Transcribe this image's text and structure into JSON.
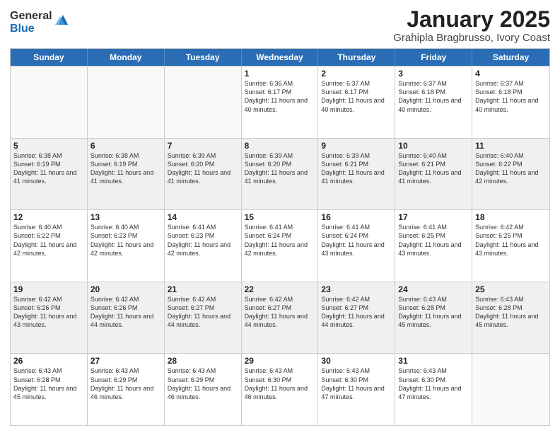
{
  "logo": {
    "general": "General",
    "blue": "Blue"
  },
  "title": {
    "month": "January 2025",
    "location": "Grahipla Bragbrusso, Ivory Coast"
  },
  "calendar": {
    "headers": [
      "Sunday",
      "Monday",
      "Tuesday",
      "Wednesday",
      "Thursday",
      "Friday",
      "Saturday"
    ],
    "rows": [
      [
        {
          "day": "",
          "info": "",
          "empty": true
        },
        {
          "day": "",
          "info": "",
          "empty": true
        },
        {
          "day": "",
          "info": "",
          "empty": true
        },
        {
          "day": "1",
          "info": "Sunrise: 6:36 AM\nSunset: 6:17 PM\nDaylight: 11 hours\nand 40 minutes."
        },
        {
          "day": "2",
          "info": "Sunrise: 6:37 AM\nSunset: 6:17 PM\nDaylight: 11 hours\nand 40 minutes."
        },
        {
          "day": "3",
          "info": "Sunrise: 6:37 AM\nSunset: 6:18 PM\nDaylight: 11 hours\nand 40 minutes."
        },
        {
          "day": "4",
          "info": "Sunrise: 6:37 AM\nSunset: 6:18 PM\nDaylight: 11 hours\nand 40 minutes."
        }
      ],
      [
        {
          "day": "5",
          "info": "Sunrise: 6:38 AM\nSunset: 6:19 PM\nDaylight: 11 hours\nand 41 minutes."
        },
        {
          "day": "6",
          "info": "Sunrise: 6:38 AM\nSunset: 6:19 PM\nDaylight: 11 hours\nand 41 minutes."
        },
        {
          "day": "7",
          "info": "Sunrise: 6:39 AM\nSunset: 6:20 PM\nDaylight: 11 hours\nand 41 minutes."
        },
        {
          "day": "8",
          "info": "Sunrise: 6:39 AM\nSunset: 6:20 PM\nDaylight: 11 hours\nand 41 minutes."
        },
        {
          "day": "9",
          "info": "Sunrise: 6:39 AM\nSunset: 6:21 PM\nDaylight: 11 hours\nand 41 minutes."
        },
        {
          "day": "10",
          "info": "Sunrise: 6:40 AM\nSunset: 6:21 PM\nDaylight: 11 hours\nand 41 minutes."
        },
        {
          "day": "11",
          "info": "Sunrise: 6:40 AM\nSunset: 6:22 PM\nDaylight: 11 hours\nand 42 minutes."
        }
      ],
      [
        {
          "day": "12",
          "info": "Sunrise: 6:40 AM\nSunset: 6:22 PM\nDaylight: 11 hours\nand 42 minutes."
        },
        {
          "day": "13",
          "info": "Sunrise: 6:40 AM\nSunset: 6:23 PM\nDaylight: 11 hours\nand 42 minutes."
        },
        {
          "day": "14",
          "info": "Sunrise: 6:41 AM\nSunset: 6:23 PM\nDaylight: 11 hours\nand 42 minutes."
        },
        {
          "day": "15",
          "info": "Sunrise: 6:41 AM\nSunset: 6:24 PM\nDaylight: 11 hours\nand 42 minutes."
        },
        {
          "day": "16",
          "info": "Sunrise: 6:41 AM\nSunset: 6:24 PM\nDaylight: 11 hours\nand 43 minutes."
        },
        {
          "day": "17",
          "info": "Sunrise: 6:41 AM\nSunset: 6:25 PM\nDaylight: 11 hours\nand 43 minutes."
        },
        {
          "day": "18",
          "info": "Sunrise: 6:42 AM\nSunset: 6:25 PM\nDaylight: 11 hours\nand 43 minutes."
        }
      ],
      [
        {
          "day": "19",
          "info": "Sunrise: 6:42 AM\nSunset: 6:26 PM\nDaylight: 11 hours\nand 43 minutes."
        },
        {
          "day": "20",
          "info": "Sunrise: 6:42 AM\nSunset: 6:26 PM\nDaylight: 11 hours\nand 44 minutes."
        },
        {
          "day": "21",
          "info": "Sunrise: 6:42 AM\nSunset: 6:27 PM\nDaylight: 11 hours\nand 44 minutes."
        },
        {
          "day": "22",
          "info": "Sunrise: 6:42 AM\nSunset: 6:27 PM\nDaylight: 11 hours\nand 44 minutes."
        },
        {
          "day": "23",
          "info": "Sunrise: 6:42 AM\nSunset: 6:27 PM\nDaylight: 11 hours\nand 44 minutes."
        },
        {
          "day": "24",
          "info": "Sunrise: 6:43 AM\nSunset: 6:28 PM\nDaylight: 11 hours\nand 45 minutes."
        },
        {
          "day": "25",
          "info": "Sunrise: 6:43 AM\nSunset: 6:28 PM\nDaylight: 11 hours\nand 45 minutes."
        }
      ],
      [
        {
          "day": "26",
          "info": "Sunrise: 6:43 AM\nSunset: 6:28 PM\nDaylight: 11 hours\nand 45 minutes."
        },
        {
          "day": "27",
          "info": "Sunrise: 6:43 AM\nSunset: 6:29 PM\nDaylight: 11 hours\nand 46 minutes."
        },
        {
          "day": "28",
          "info": "Sunrise: 6:43 AM\nSunset: 6:29 PM\nDaylight: 11 hours\nand 46 minutes."
        },
        {
          "day": "29",
          "info": "Sunrise: 6:43 AM\nSunset: 6:30 PM\nDaylight: 11 hours\nand 46 minutes."
        },
        {
          "day": "30",
          "info": "Sunrise: 6:43 AM\nSunset: 6:30 PM\nDaylight: 11 hours\nand 47 minutes."
        },
        {
          "day": "31",
          "info": "Sunrise: 6:43 AM\nSunset: 6:30 PM\nDaylight: 11 hours\nand 47 minutes."
        },
        {
          "day": "",
          "info": "",
          "empty": true
        }
      ]
    ]
  }
}
